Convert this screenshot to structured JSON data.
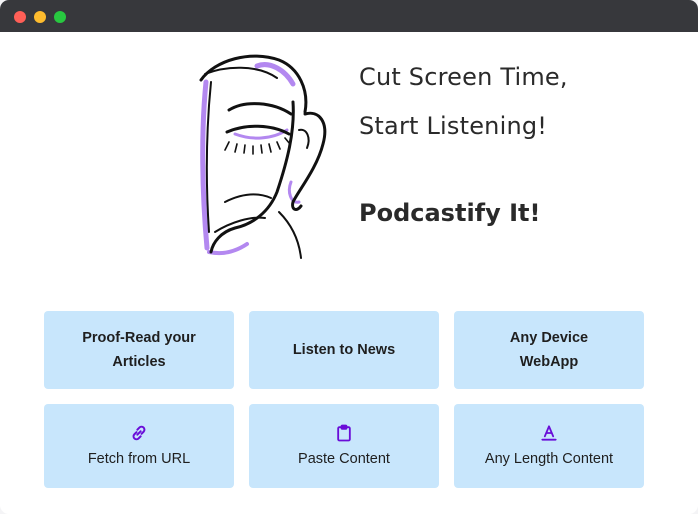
{
  "window": {
    "controls": {
      "close": {
        "icon": "close-dot",
        "color": "#ff5f57"
      },
      "minimize": {
        "icon": "minimize-dot",
        "color": "#febc2e"
      },
      "maximize": {
        "icon": "maximize-dot",
        "color": "#28c840"
      }
    }
  },
  "hero": {
    "headline_line1": "Cut Screen Time,",
    "headline_line2": "Start Listening!",
    "brand": "Podcastify It!",
    "illustration": "face-line-art",
    "accent_color": "#b388f0"
  },
  "features": [
    {
      "line1": "Proof-Read your",
      "line2": "Articles"
    },
    {
      "line1": "Listen to News"
    },
    {
      "line1": "Any Device",
      "line2": "WebApp"
    }
  ],
  "actions": [
    {
      "label": "Fetch from URL",
      "icon": "link-icon"
    },
    {
      "label": "Paste Content",
      "icon": "clipboard-icon"
    },
    {
      "label": "Any Length Content",
      "icon": "text-format-icon"
    }
  ],
  "colors": {
    "card_background": "#c8e6fc",
    "icon_color": "#6a0dd8",
    "titlebar": "#37383c"
  }
}
